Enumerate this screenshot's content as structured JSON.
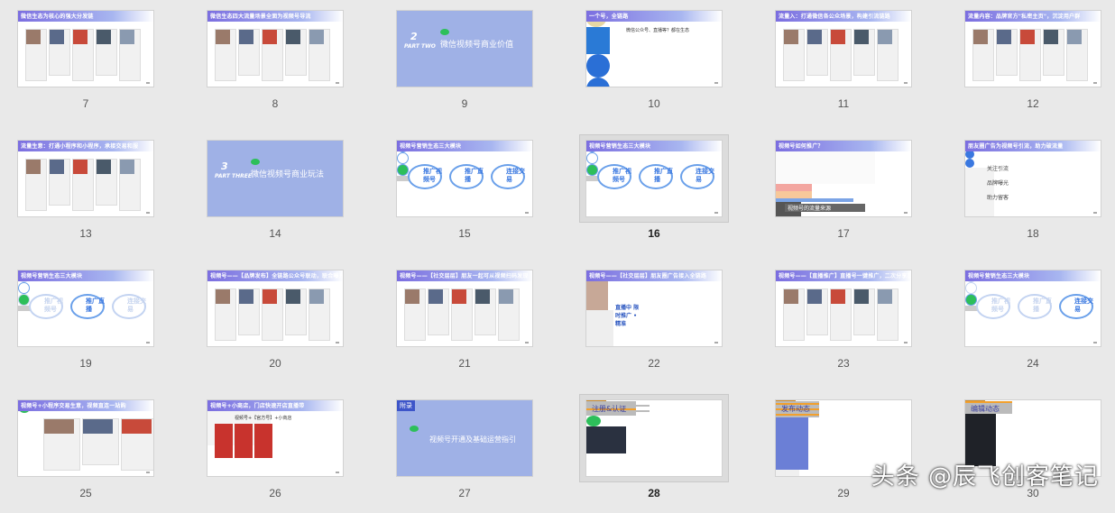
{
  "slides": [
    {
      "number": "7",
      "title": "微信生态为核心的强大分发链"
    },
    {
      "number": "8",
      "title": "微信生态四大流量场景全面为视频号导流"
    },
    {
      "number": "9",
      "part": "PART TWO",
      "index": "2",
      "title": "微信视频号商业价值"
    },
    {
      "number": "10",
      "title": "一个号，全链路",
      "bubble": "微信公众号、直播等？都在生态"
    },
    {
      "number": "11",
      "title": "流量入：打通微信各公众场景，构建引流链路"
    },
    {
      "number": "12",
      "title": "流量内容：品牌官方\"私密主页\"，沉淀用户群"
    },
    {
      "number": "13",
      "title": "流量生意：打通小程序和小程序，承接交易和服"
    },
    {
      "number": "14",
      "part": "PART THREE",
      "index": "3",
      "title": "微信视频号商业玩法"
    },
    {
      "number": "15",
      "title": "视频号营销生态三大模块",
      "circles": [
        "推广视频号",
        "推广直播",
        "连接交易"
      ]
    },
    {
      "number": "16",
      "title": "视频号营销生态三大模块",
      "circles": [
        "推广视频号",
        "推广直播",
        "连接交易"
      ],
      "selected": true
    },
    {
      "number": "17",
      "title": "视频号如何推广？",
      "footer": "视频号的流量来源"
    },
    {
      "number": "18",
      "title": "朋友圈广告为视频号引流，助力破流量",
      "items": [
        "关注引流",
        "品牌曝光",
        "助力留客"
      ]
    },
    {
      "number": "19",
      "title": "视频号营销生态三大模块",
      "circles": [
        "推广视频号",
        "推广直播",
        "连接交易"
      ]
    },
    {
      "number": "20",
      "title": "视频号——【品牌发布】全链路公众号联动，联合曝光"
    },
    {
      "number": "21",
      "title": "视频号——【社交层层】朋友一起可从视频扫码发现"
    },
    {
      "number": "22",
      "title": "视频号——【社交层层】朋友圈广告接入全链路",
      "callout": "直播中 限时推广 • 精准"
    },
    {
      "number": "23",
      "title": "视频号——【直播推广】直播号一键推广，二次分享投流"
    },
    {
      "number": "24",
      "title": "视频号营销生态三大模块",
      "circles": [
        "推广视频号",
        "推广直播",
        "连接交易"
      ]
    },
    {
      "number": "25",
      "title": "视频号+小程序交易生意，视频直连一站购"
    },
    {
      "number": "26",
      "title": "视频号+小商店，门店快速开店直播带",
      "label": "视频号+【官方号】+小商店"
    },
    {
      "number": "27",
      "tag": "附录",
      "title": "视频号开通及基础运营指引"
    },
    {
      "number": "28",
      "title": "注册&认证",
      "selected": true
    },
    {
      "number": "29",
      "title": "发布动态"
    },
    {
      "number": "30",
      "title": "编辑动态"
    }
  ],
  "watermark": "头条 @辰飞创客笔记"
}
